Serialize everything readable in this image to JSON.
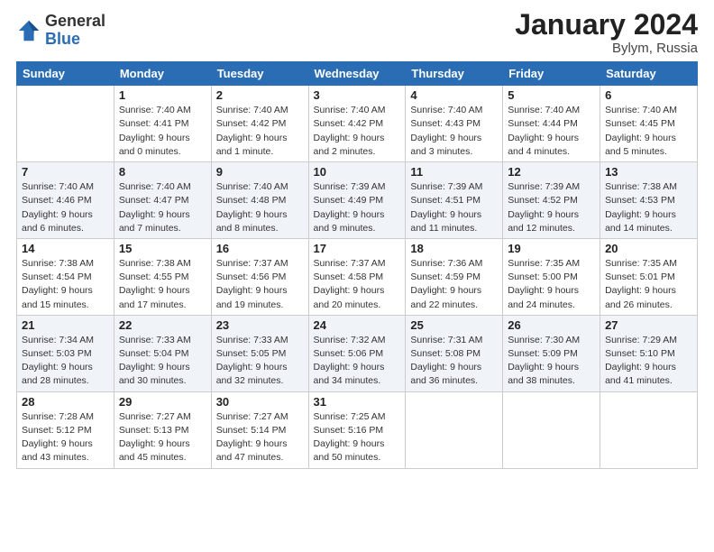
{
  "header": {
    "logo_general": "General",
    "logo_blue": "Blue",
    "month_year": "January 2024",
    "location": "Bylym, Russia"
  },
  "weekdays": [
    "Sunday",
    "Monday",
    "Tuesday",
    "Wednesday",
    "Thursday",
    "Friday",
    "Saturday"
  ],
  "weeks": [
    [
      {
        "day": "",
        "sunrise": "",
        "sunset": "",
        "daylight": ""
      },
      {
        "day": "1",
        "sunrise": "Sunrise: 7:40 AM",
        "sunset": "Sunset: 4:41 PM",
        "daylight": "Daylight: 9 hours and 0 minutes."
      },
      {
        "day": "2",
        "sunrise": "Sunrise: 7:40 AM",
        "sunset": "Sunset: 4:42 PM",
        "daylight": "Daylight: 9 hours and 1 minute."
      },
      {
        "day": "3",
        "sunrise": "Sunrise: 7:40 AM",
        "sunset": "Sunset: 4:42 PM",
        "daylight": "Daylight: 9 hours and 2 minutes."
      },
      {
        "day": "4",
        "sunrise": "Sunrise: 7:40 AM",
        "sunset": "Sunset: 4:43 PM",
        "daylight": "Daylight: 9 hours and 3 minutes."
      },
      {
        "day": "5",
        "sunrise": "Sunrise: 7:40 AM",
        "sunset": "Sunset: 4:44 PM",
        "daylight": "Daylight: 9 hours and 4 minutes."
      },
      {
        "day": "6",
        "sunrise": "Sunrise: 7:40 AM",
        "sunset": "Sunset: 4:45 PM",
        "daylight": "Daylight: 9 hours and 5 minutes."
      }
    ],
    [
      {
        "day": "7",
        "sunrise": "Sunrise: 7:40 AM",
        "sunset": "Sunset: 4:46 PM",
        "daylight": "Daylight: 9 hours and 6 minutes."
      },
      {
        "day": "8",
        "sunrise": "Sunrise: 7:40 AM",
        "sunset": "Sunset: 4:47 PM",
        "daylight": "Daylight: 9 hours and 7 minutes."
      },
      {
        "day": "9",
        "sunrise": "Sunrise: 7:40 AM",
        "sunset": "Sunset: 4:48 PM",
        "daylight": "Daylight: 9 hours and 8 minutes."
      },
      {
        "day": "10",
        "sunrise": "Sunrise: 7:39 AM",
        "sunset": "Sunset: 4:49 PM",
        "daylight": "Daylight: 9 hours and 9 minutes."
      },
      {
        "day": "11",
        "sunrise": "Sunrise: 7:39 AM",
        "sunset": "Sunset: 4:51 PM",
        "daylight": "Daylight: 9 hours and 11 minutes."
      },
      {
        "day": "12",
        "sunrise": "Sunrise: 7:39 AM",
        "sunset": "Sunset: 4:52 PM",
        "daylight": "Daylight: 9 hours and 12 minutes."
      },
      {
        "day": "13",
        "sunrise": "Sunrise: 7:38 AM",
        "sunset": "Sunset: 4:53 PM",
        "daylight": "Daylight: 9 hours and 14 minutes."
      }
    ],
    [
      {
        "day": "14",
        "sunrise": "Sunrise: 7:38 AM",
        "sunset": "Sunset: 4:54 PM",
        "daylight": "Daylight: 9 hours and 15 minutes."
      },
      {
        "day": "15",
        "sunrise": "Sunrise: 7:38 AM",
        "sunset": "Sunset: 4:55 PM",
        "daylight": "Daylight: 9 hours and 17 minutes."
      },
      {
        "day": "16",
        "sunrise": "Sunrise: 7:37 AM",
        "sunset": "Sunset: 4:56 PM",
        "daylight": "Daylight: 9 hours and 19 minutes."
      },
      {
        "day": "17",
        "sunrise": "Sunrise: 7:37 AM",
        "sunset": "Sunset: 4:58 PM",
        "daylight": "Daylight: 9 hours and 20 minutes."
      },
      {
        "day": "18",
        "sunrise": "Sunrise: 7:36 AM",
        "sunset": "Sunset: 4:59 PM",
        "daylight": "Daylight: 9 hours and 22 minutes."
      },
      {
        "day": "19",
        "sunrise": "Sunrise: 7:35 AM",
        "sunset": "Sunset: 5:00 PM",
        "daylight": "Daylight: 9 hours and 24 minutes."
      },
      {
        "day": "20",
        "sunrise": "Sunrise: 7:35 AM",
        "sunset": "Sunset: 5:01 PM",
        "daylight": "Daylight: 9 hours and 26 minutes."
      }
    ],
    [
      {
        "day": "21",
        "sunrise": "Sunrise: 7:34 AM",
        "sunset": "Sunset: 5:03 PM",
        "daylight": "Daylight: 9 hours and 28 minutes."
      },
      {
        "day": "22",
        "sunrise": "Sunrise: 7:33 AM",
        "sunset": "Sunset: 5:04 PM",
        "daylight": "Daylight: 9 hours and 30 minutes."
      },
      {
        "day": "23",
        "sunrise": "Sunrise: 7:33 AM",
        "sunset": "Sunset: 5:05 PM",
        "daylight": "Daylight: 9 hours and 32 minutes."
      },
      {
        "day": "24",
        "sunrise": "Sunrise: 7:32 AM",
        "sunset": "Sunset: 5:06 PM",
        "daylight": "Daylight: 9 hours and 34 minutes."
      },
      {
        "day": "25",
        "sunrise": "Sunrise: 7:31 AM",
        "sunset": "Sunset: 5:08 PM",
        "daylight": "Daylight: 9 hours and 36 minutes."
      },
      {
        "day": "26",
        "sunrise": "Sunrise: 7:30 AM",
        "sunset": "Sunset: 5:09 PM",
        "daylight": "Daylight: 9 hours and 38 minutes."
      },
      {
        "day": "27",
        "sunrise": "Sunrise: 7:29 AM",
        "sunset": "Sunset: 5:10 PM",
        "daylight": "Daylight: 9 hours and 41 minutes."
      }
    ],
    [
      {
        "day": "28",
        "sunrise": "Sunrise: 7:28 AM",
        "sunset": "Sunset: 5:12 PM",
        "daylight": "Daylight: 9 hours and 43 minutes."
      },
      {
        "day": "29",
        "sunrise": "Sunrise: 7:27 AM",
        "sunset": "Sunset: 5:13 PM",
        "daylight": "Daylight: 9 hours and 45 minutes."
      },
      {
        "day": "30",
        "sunrise": "Sunrise: 7:27 AM",
        "sunset": "Sunset: 5:14 PM",
        "daylight": "Daylight: 9 hours and 47 minutes."
      },
      {
        "day": "31",
        "sunrise": "Sunrise: 7:25 AM",
        "sunset": "Sunset: 5:16 PM",
        "daylight": "Daylight: 9 hours and 50 minutes."
      },
      {
        "day": "",
        "sunrise": "",
        "sunset": "",
        "daylight": ""
      },
      {
        "day": "",
        "sunrise": "",
        "sunset": "",
        "daylight": ""
      },
      {
        "day": "",
        "sunrise": "",
        "sunset": "",
        "daylight": ""
      }
    ]
  ]
}
